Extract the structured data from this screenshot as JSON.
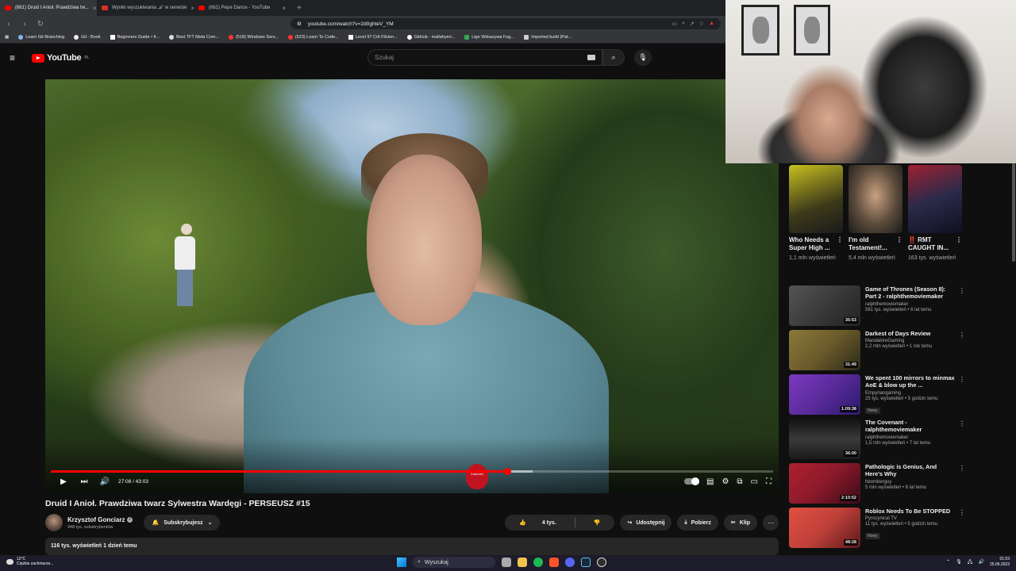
{
  "browser": {
    "tabs": [
      {
        "title": "(661) Druid I Anioł. Prawdziwa tw...",
        "active": true,
        "fav": "youtube"
      },
      {
        "title": "Wyniki wyszukiwania „a\" w serwisie",
        "active": false,
        "fav": "page"
      },
      {
        "title": "(661) Pepe Dance - YouTube",
        "active": false,
        "fav": "youtube"
      }
    ],
    "url": "youtube.com/watch?v=2d0ghteV_YM",
    "bookmarks": [
      "Learn Git Branching",
      "Git - Book",
      "Beginners Guide • fr...",
      "Best TFT Meta Com...",
      "(518) Windows Serv...",
      "(523) Learn To Code...",
      "Level 97 Crit Flicker...",
      "GitHub - mallahyeri...",
      "Lige Wskazywa Fug...",
      "Imported build (Pat..."
    ]
  },
  "youtube": {
    "logo_text": "YouTube",
    "logo_region": "PL",
    "search_placeholder": "Szukaj"
  },
  "player": {
    "time_label": "27:08 / 43:03",
    "progress": 0.632,
    "buffered": 0.667,
    "heart_text": "Carburex"
  },
  "video": {
    "title": "Druid I Anioł. Prawdziwa twarz Sylwestra Wardęgi - PERSEUSZ #15",
    "channel": "Krzysztof Gonciarz",
    "subscribers": "948 tys. subskrybentów",
    "subscribe_label": "Subskrybujesz",
    "likes": "4 tys.",
    "share_label": "Udostępnij",
    "download_label": "Pobierz",
    "clip_label": "Klip",
    "stats": "116 tys. wyświetleń  1 dzień temu"
  },
  "shorts": [
    {
      "title": "Who Needs a Super High ...",
      "views": "1,1 mln wyświetleń",
      "color": "#3d3a1a"
    },
    {
      "title": "I'm old Testament!...",
      "views": "5,4 mln wyświetleń",
      "color": "#5a4a3a"
    },
    {
      "title": "‼️ RMT CAUGHT IN...",
      "views": "163 tys. wyświetleń",
      "color": "#2a2a4a"
    }
  ],
  "recommended": [
    {
      "title": "Game of Thrones (Season 8): Part 2 - ralphthemoviemaker",
      "channel": "ralphthemoviemaker",
      "meta": "561 tys. wyświetleń • 6 lat temu",
      "duration": "35:53",
      "badge": "",
      "thumb": "#3a3a3a"
    },
    {
      "title": "Darkest of Days Review",
      "channel": "MandaloreGaming",
      "meta": "2,2 mln wyświetleń • 1 rok temu",
      "duration": "31:49",
      "badge": "",
      "thumb": "#6b5a2a"
    },
    {
      "title": "We spent 100 mirrors to minmax AoE & blow up the ...",
      "channel": "Empyriangaming",
      "meta": "25 tys. wyświetleń • 5 godzin temu",
      "duration": "1:09:38",
      "badge": "Nowy",
      "thumb": "#5a2a9a"
    },
    {
      "title": "The Covenant - ralphthemoviemaker",
      "channel": "ralphthemoviemaker",
      "meta": "1,5 mln wyświetleń • 7 lat temu",
      "duration": "36:00",
      "badge": "",
      "thumb": "#2a2a2a"
    },
    {
      "title": "Pathologic is Genius, And Here's Why",
      "channel": "hbomberguy",
      "meta": "5 mln wyświetleń • 6 lat temu",
      "duration": "2:10:52",
      "badge": "",
      "thumb": "#8a1a2a"
    },
    {
      "title": "Roblox Needs To Be STOPPED",
      "channel": "Pyrocynical TV",
      "meta": "11 tys. wyświetleń • 5 godzin temu",
      "duration": "48:28",
      "badge": "Nowy",
      "thumb": "#c0403a"
    }
  ],
  "taskbar": {
    "weather_temp": "12°C",
    "weather_desc": "Ciężkie zachmurze...",
    "search_label": "Wyszukaj",
    "time": "01:03",
    "date": "25.06.2023"
  }
}
